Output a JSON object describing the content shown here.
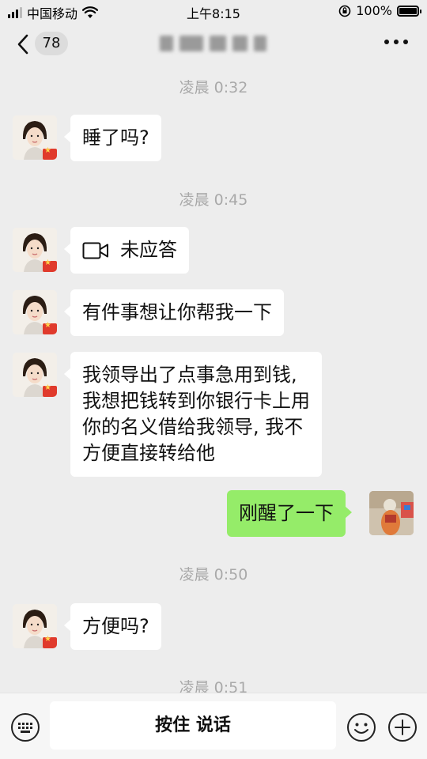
{
  "status_bar": {
    "carrier": "中国移动",
    "time": "上午8:15",
    "battery": "100%"
  },
  "header": {
    "unread_count": "78"
  },
  "messages": [
    {
      "type": "time",
      "text": "凌晨 0:32"
    },
    {
      "type": "text",
      "from": "contact",
      "text": "睡了吗?"
    },
    {
      "type": "time",
      "text": "凌晨 0:45"
    },
    {
      "type": "video_call",
      "from": "contact",
      "text": "未应答",
      "icon": "video-call-icon"
    },
    {
      "type": "text",
      "from": "contact",
      "text": "有件事想让你帮我一下"
    },
    {
      "type": "text",
      "from": "contact",
      "lines": [
        "我领导出了点事急用到钱,",
        "我想把钱转到你银行卡上用",
        "你的名义借给我领导, 我不",
        "方便直接转给他"
      ]
    },
    {
      "type": "text",
      "from": "me",
      "text": "刚醒了一下"
    },
    {
      "type": "time",
      "text": "凌晨 0:50"
    },
    {
      "type": "text",
      "from": "contact",
      "text": "方便吗?"
    },
    {
      "type": "time",
      "text": "凌晨 0:51"
    }
  ],
  "input_bar": {
    "hold_to_talk": "按住 说话",
    "icons": [
      "keyboard-icon",
      "emoji-icon",
      "plus-icon"
    ]
  },
  "colors": {
    "background": "#ededed",
    "my_bubble": "#95ec69",
    "their_bubble": "#ffffff",
    "timestamp": "#a9a9a9"
  }
}
